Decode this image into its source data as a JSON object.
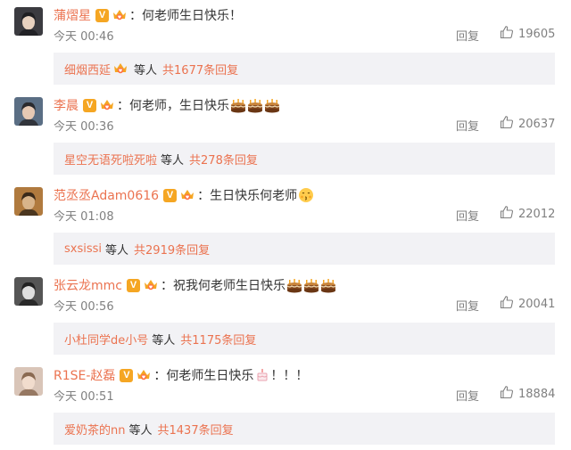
{
  "comments": [
    {
      "username": "蒲熠星",
      "vip_badge": "V",
      "text": "何老师生日快乐！",
      "emoji": [],
      "time": "今天 00:46",
      "reply_label": "回复",
      "likes": "19605",
      "sub": {
        "name": "细烟西延",
        "by_label": "等人",
        "total": "共1677条回复",
        "has_crown": true
      },
      "avatar_color": "#3b3b40"
    },
    {
      "username": "李晨",
      "vip_badge": "V",
      "text": "何老师，生日快乐",
      "emoji": [
        "cake-icon",
        "cake-icon",
        "cake-icon"
      ],
      "time": "今天 00:36",
      "reply_label": "回复",
      "likes": "20637",
      "sub": {
        "name": "星空无语死啦死啦",
        "by_label": "等人",
        "total": "共278条回复",
        "has_crown": false
      },
      "avatar_color": "#5a6e84"
    },
    {
      "username": "范丞丞Adam0616",
      "vip_badge": "V",
      "text": "生日快乐何老师",
      "emoji": [
        "kiss-face-icon"
      ],
      "time": "今天 01:08",
      "reply_label": "回复",
      "likes": "22012",
      "sub": {
        "name": "sxsissi",
        "by_label": "等人",
        "total": "共2919条回复",
        "has_crown": false
      },
      "avatar_color": "#b07a3e"
    },
    {
      "username": "张云龙mmc",
      "vip_badge": "V",
      "text": "祝我何老师生日快乐",
      "emoji": [
        "cake-icon",
        "cake-icon",
        "cake-icon"
      ],
      "time": "今天 00:56",
      "reply_label": "回复",
      "likes": "20041",
      "sub": {
        "name": "小杜同学de小号",
        "by_label": "等人",
        "total": "共1175条回复",
        "has_crown": false
      },
      "avatar_color": "#555555"
    },
    {
      "username": "R1SE-赵磊",
      "vip_badge": "V",
      "text": "何老师生日快乐",
      "emoji": [
        "small-cake-icon"
      ],
      "text_after": "！！！",
      "time": "今天 00:51",
      "reply_label": "回复",
      "likes": "18884",
      "sub": {
        "name": "爱奶茶的nn",
        "by_label": "等人",
        "total": "共1437条回复",
        "has_crown": false
      },
      "avatar_color": "#d9c5b8"
    }
  ],
  "colon": "：",
  "colors": {
    "accent": "#eb7350",
    "meta": "#808080",
    "sub_bg": "#f2f2f5",
    "vip": "#f5a623"
  }
}
